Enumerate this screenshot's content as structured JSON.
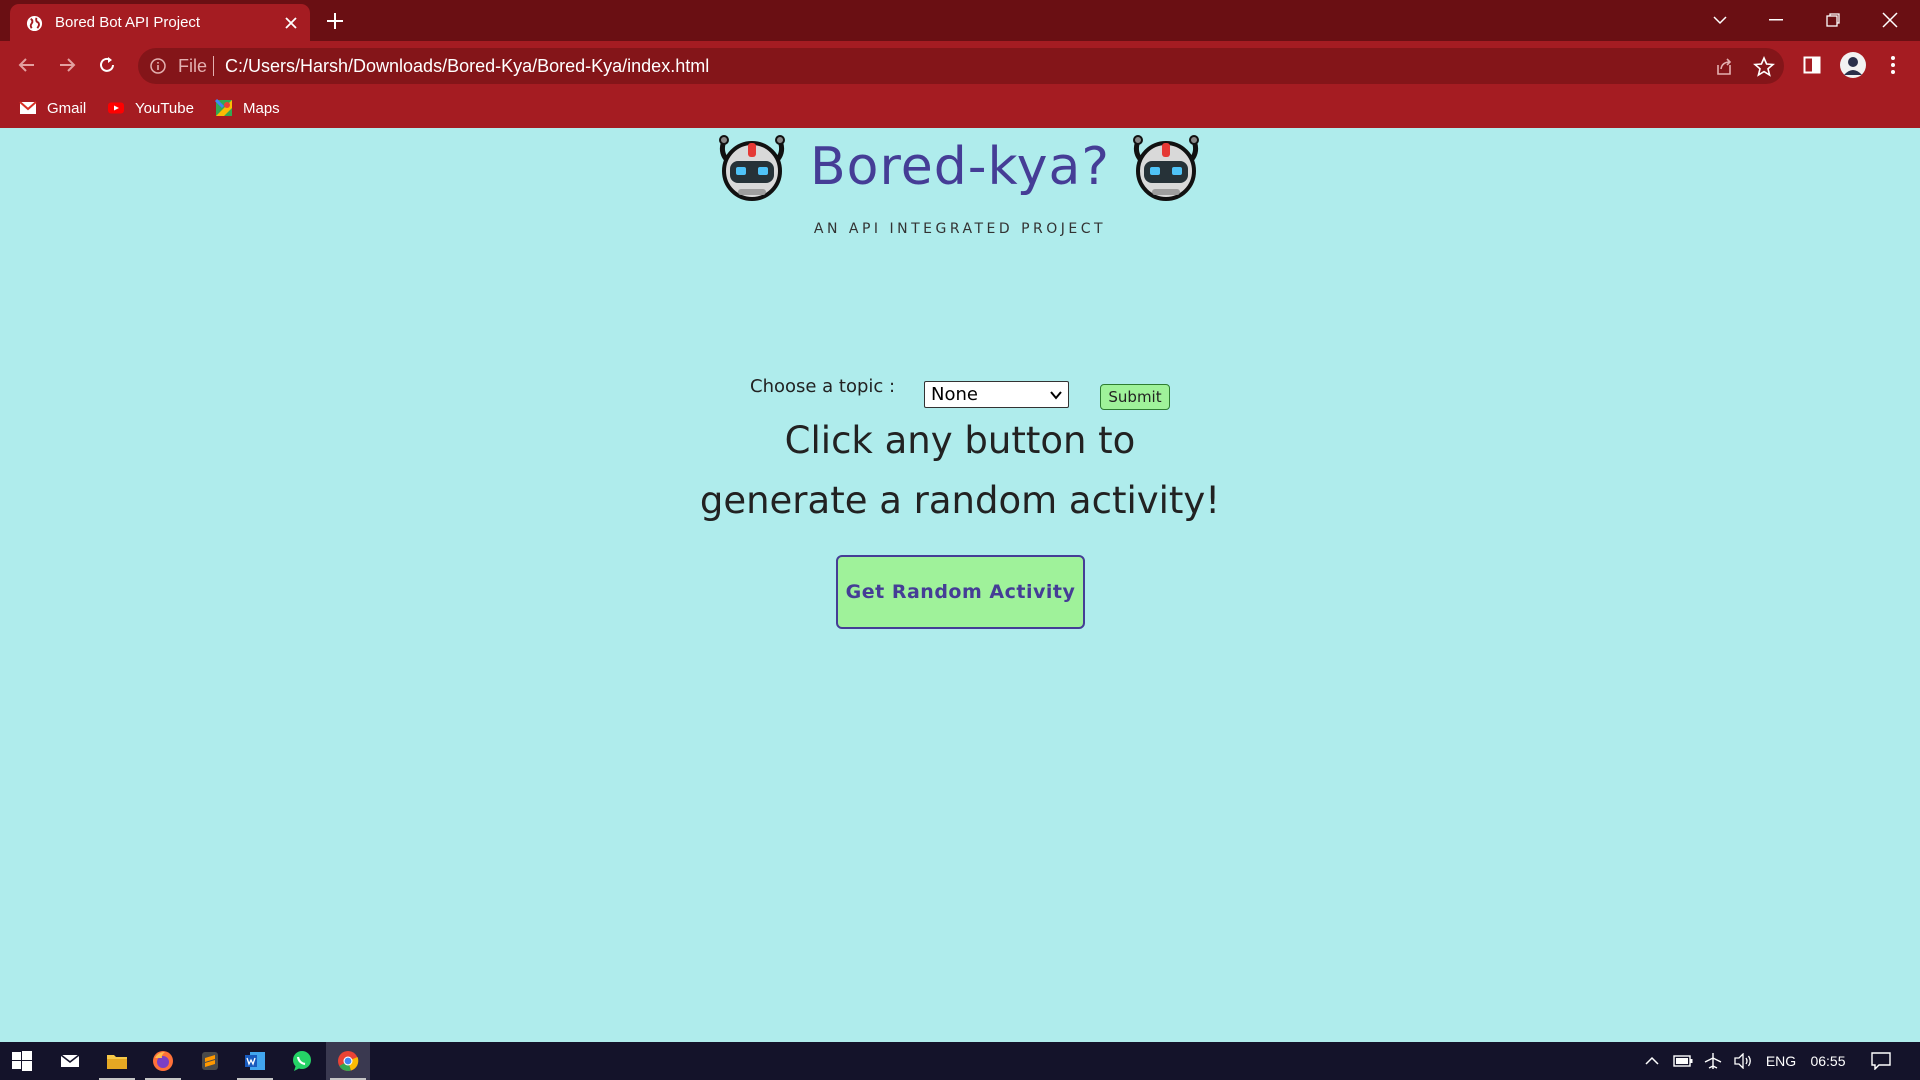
{
  "browser": {
    "tab_title": "Bored Bot API Project",
    "url_scheme": "File",
    "url": "C:/Users/Harsh/Downloads/Bored-Kya/Bored-Kya/index.html",
    "bookmarks": [
      {
        "label": "Gmail",
        "icon": "gmail-icon"
      },
      {
        "label": "YouTube",
        "icon": "youtube-icon"
      },
      {
        "label": "Maps",
        "icon": "maps-icon"
      }
    ],
    "theme_color": "#a51c22"
  },
  "page": {
    "title": "Bored-kya?",
    "subtitle": "AN API INTEGRATED PROJECT",
    "topic_label": "Choose a topic :",
    "topic_selected": "None",
    "submit_label": "Submit",
    "prompt_line1": "Click any button to",
    "prompt_line2": "generate a random activity!",
    "random_button_label": "Get Random Activity",
    "background_color": "#afecec",
    "accent_color": "#453d96",
    "button_color": "#9ff29a"
  },
  "taskbar": {
    "apps": [
      "windows-start-icon",
      "mail-icon",
      "file-explorer-icon",
      "firefox-icon",
      "sublime-text-icon",
      "word-icon",
      "whatsapp-icon",
      "chrome-icon"
    ],
    "language": "ENG",
    "time": "06:55"
  }
}
